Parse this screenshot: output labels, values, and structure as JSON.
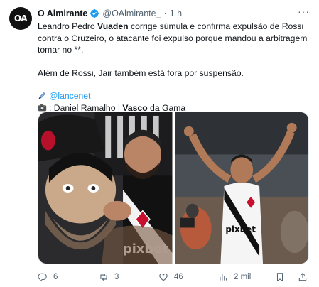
{
  "tweet": {
    "avatar_text": "OA",
    "author_name": "O Almirante",
    "handle": "@OAlmirante_",
    "separator": "·",
    "time": "1 h",
    "more_label": "···",
    "text": {
      "line1_pre": "Leandro Pedro ",
      "line1_bold": "Vuaden",
      "line1_post": " corrige súmula e confirma expulsão de Rossi contra o Cruzeiro, o atacante foi expulso porque mandou a arbitragem tomar no **.",
      "line2": "Além de Rossi, Jair também está fora por suspensão.",
      "link": "@lancenet",
      "credit_pre": ": Daniel Ramalho | ",
      "credit_bold": "Vasco",
      "credit_post": " da Gama"
    },
    "media_left_text": "pixbet",
    "media_right_text": "pixbet"
  },
  "actions": {
    "replies": "6",
    "retweets": "3",
    "likes": "46",
    "views": "2 mil"
  },
  "colors": {
    "accent": "#1d9bf0",
    "muted": "#536471",
    "text": "#0f1419"
  }
}
